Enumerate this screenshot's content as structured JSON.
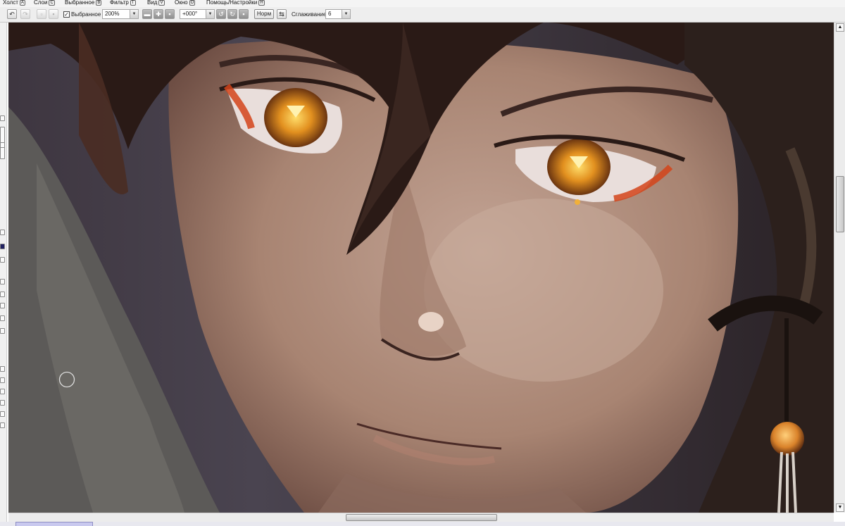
{
  "menu": [
    {
      "label": "Холст",
      "key": "A"
    },
    {
      "label": "Слои",
      "key": "C"
    },
    {
      "label": "Выбранное",
      "key": "B"
    },
    {
      "label": "Фильтр",
      "key": "T"
    },
    {
      "label": "Вид",
      "key": "V"
    },
    {
      "label": "Окно",
      "key": "O"
    },
    {
      "label": "Помощь/Настройки",
      "key": "H"
    }
  ],
  "toolbar": {
    "undo_icon": "undo-icon",
    "redo_icon": "redo-icon",
    "selection_checkbox_checked": true,
    "selection_label": "Выбранное",
    "zoom_value": "200%",
    "rotation_value": "+000°",
    "blend_label": "Норм",
    "smoothing_label": "Сглаживание",
    "smoothing_value": "6"
  },
  "canvas": {
    "content": "painted-anime-portrait",
    "brush_cursor": "circle"
  },
  "colors": {
    "menu_bg": "#f4f4f4",
    "toolbar_bg": "#eeeeee",
    "eye_glow": "#e89a2a",
    "skin": "#b89888",
    "hair": "#2a1a16",
    "status_tab": "#c9c9ef"
  }
}
